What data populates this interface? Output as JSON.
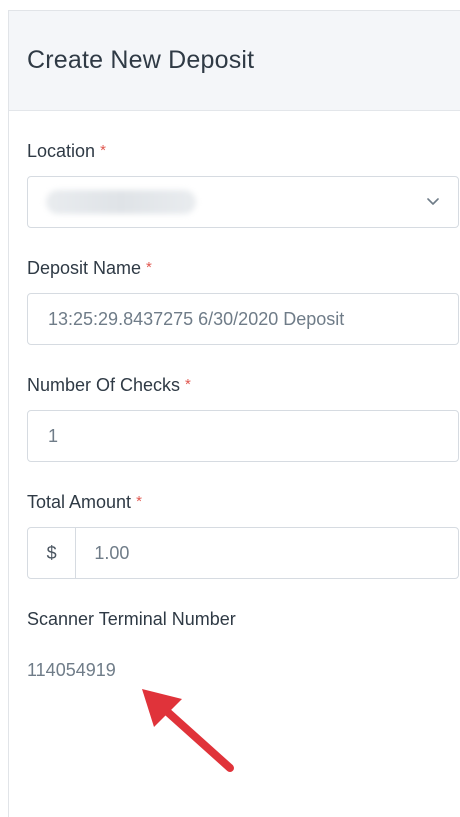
{
  "header": {
    "title": "Create New Deposit"
  },
  "form": {
    "location": {
      "label": "Location",
      "required_mark": "*"
    },
    "deposit_name": {
      "label": "Deposit Name",
      "required_mark": "*",
      "value": "13:25:29.8437275 6/30/2020 Deposit"
    },
    "number_of_checks": {
      "label": "Number Of Checks",
      "required_mark": "*",
      "value": "1"
    },
    "total_amount": {
      "label": "Total Amount",
      "required_mark": "*",
      "currency_symbol": "$",
      "value": "1.00"
    },
    "scanner_terminal": {
      "label": "Scanner Terminal Number",
      "value": "114054919"
    }
  },
  "colors": {
    "required": "#e0574f",
    "annotation_arrow": "#e0333a"
  }
}
